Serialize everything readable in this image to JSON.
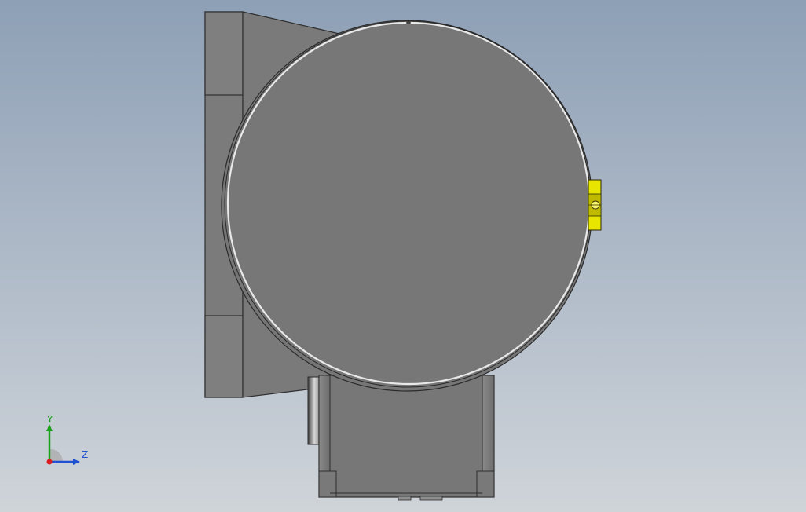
{
  "viewport": {
    "background_top": "#8ea0b6",
    "background_bottom": "#cfd4d9"
  },
  "model": {
    "body_color": "#7a7a7a",
    "edge_color": "#2a2a2a",
    "accent_color": "#e7e400"
  },
  "triad": {
    "y_label": "Y",
    "z_label": "Z",
    "y_color": "#19a319",
    "z_color": "#1f4fd3",
    "origin_color": "#d71e1e"
  }
}
